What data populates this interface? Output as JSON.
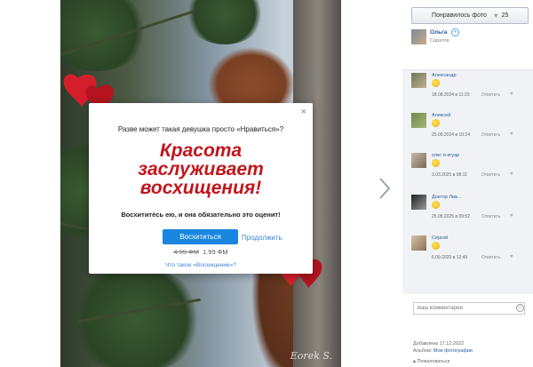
{
  "sidebar": {
    "like_button": {
      "label": "Понравилось фото",
      "count": "25"
    },
    "author": {
      "name": "Ольга",
      "city": "Саратов"
    },
    "comments": [
      {
        "name": "Александр",
        "date": "18.08.2024 в 11:25",
        "reply": "Ответить"
      },
      {
        "name": "Алексей",
        "date": "25.09.2024 в 10:24",
        "reply": "Ответить"
      },
      {
        "name": "олег и игуар",
        "date": "3.03.2025 в 08:11",
        "reply": "Ответить"
      },
      {
        "name": "Доктор Лив...",
        "date": "25.05.2025 в 09:52",
        "reply": "Ответить"
      },
      {
        "name": "Сергей",
        "date": "6.09.2025 в 12:49",
        "reply": "Ответить"
      }
    ],
    "comment_placeholder": "Ваш комментарий",
    "added": "Добавлена 17.12.2022",
    "album_prefix": "Альбом:",
    "album_link": "Мои фотографии",
    "report": "Пожаловаться"
  },
  "modal": {
    "question": "Разве может такая девушка просто «Нравиться»?",
    "headline_line1": "Красота",
    "headline_line2": "заслуживает",
    "headline_line3": "восхищения!",
    "cta_text": "Восхитите́сь ею, и она обязательно это оценит!",
    "admire_button": "Восхититься",
    "continue_link": "Продолжить",
    "old_price": "4.99 ФМ",
    "new_price": "1.99 ФМ",
    "what_link": "Что такое «Восхищение»?",
    "close": "×"
  },
  "photo": {
    "signature": "Eorek S."
  },
  "colors": {
    "accent": "#1a86e0",
    "headline": "#c2161d",
    "link": "#2a5d9f"
  }
}
